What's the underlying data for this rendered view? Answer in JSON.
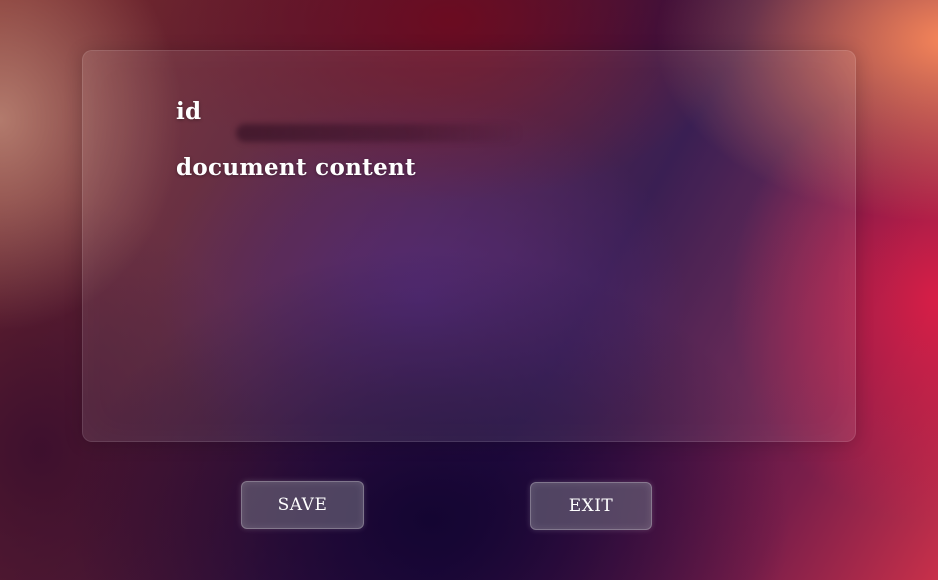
{
  "form": {
    "id_label": "id",
    "id_value": "",
    "content_label": "document content",
    "content_value": ""
  },
  "actions": {
    "save_label": "SAVE",
    "exit_label": "EXIT"
  }
}
